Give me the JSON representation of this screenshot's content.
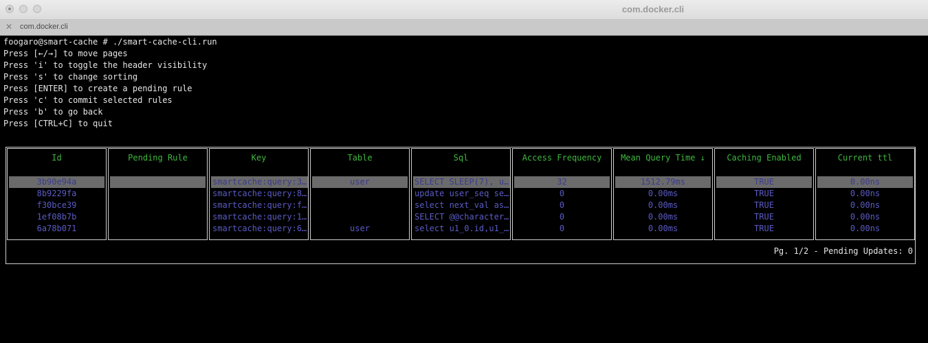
{
  "window": {
    "title": "com.docker.cli"
  },
  "tab": {
    "label": "com.docker.cli"
  },
  "terminal": {
    "lines": [
      "foogaro@smart-cache # ./smart-cache-cli.run",
      "Press [←/→] to move pages",
      "Press 'i' to toggle the header visibility",
      "Press 's' to change sorting",
      "Press [ENTER] to create a pending rule",
      "Press 'c' to commit selected rules",
      "Press 'b' to go back",
      "Press [CTRL+C] to quit"
    ]
  },
  "table": {
    "columns": [
      "Id",
      "Pending Rule",
      "Key",
      "Table",
      "Sql",
      "Access Frequency",
      "Mean Query Time ↓",
      "Caching Enabled",
      "Current ttl"
    ],
    "rows": [
      {
        "id": "3b90e94a",
        "pending": "",
        "key": "smartcache:query:3b…",
        "table": "user",
        "sql": "SELECT SLEEP(7), u…",
        "freq": "32",
        "mean": "1512.79ms",
        "caching": "TRUE",
        "ttl": "0.00ns",
        "selected": true
      },
      {
        "id": "8b9229fa",
        "pending": "",
        "key": "smartcache:query:8b…",
        "table": "",
        "sql": "update user_seq set…",
        "freq": "0",
        "mean": "0.00ms",
        "caching": "TRUE",
        "ttl": "0.00ns",
        "selected": false
      },
      {
        "id": "f30bce39",
        "pending": "",
        "key": "smartcache:query:f3…",
        "table": "",
        "sql": "select next_val as …",
        "freq": "0",
        "mean": "0.00ms",
        "caching": "TRUE",
        "ttl": "0.00ns",
        "selected": false
      },
      {
        "id": "1ef08b7b",
        "pending": "",
        "key": "smartcache:query:1e…",
        "table": "",
        "sql": "SELECT @@character_…",
        "freq": "0",
        "mean": "0.00ms",
        "caching": "TRUE",
        "ttl": "0.00ns",
        "selected": false
      },
      {
        "id": "6a78b071",
        "pending": "",
        "key": "smartcache:query:6a…",
        "table": "user",
        "sql": "select u1_0.id,u1_0…",
        "freq": "0",
        "mean": "0.00ms",
        "caching": "TRUE",
        "ttl": "0.00ns",
        "selected": false
      }
    ],
    "footer": "Pg. 1/2 - Pending Updates: 0"
  },
  "colors": {
    "header_text": "#3fb83f",
    "cell_text": "#5b5bc4",
    "selection_bg": "#6b6b6b",
    "background": "#000000"
  }
}
